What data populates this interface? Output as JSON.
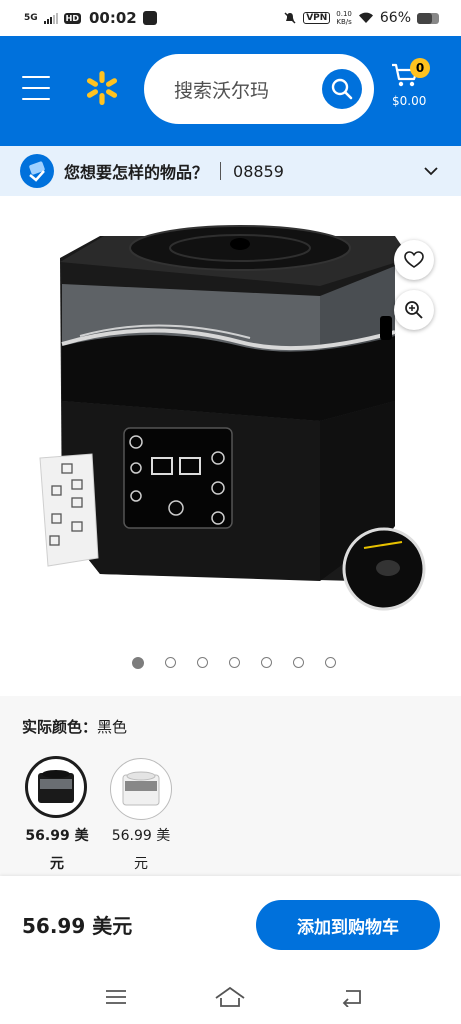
{
  "status_bar": {
    "network": "5G",
    "hd": "HD",
    "time": "00:02",
    "vpn": "VPN",
    "speed_value": "0.10",
    "speed_unit": "KB/s",
    "battery": "66%",
    "icons": [
      "signal-icon",
      "app-notification-icon",
      "mute-icon",
      "vpn-icon",
      "wifi-icon",
      "battery-icon"
    ]
  },
  "header": {
    "search_placeholder": "搜索沃尔玛",
    "cart_count": "0",
    "cart_total": "$0.00",
    "brand_color": "#0071dc",
    "badge_color": "#ffc220"
  },
  "location": {
    "question": "您想要怎样的物品？",
    "zip": "08859"
  },
  "gallery": {
    "image_count": 7,
    "active_index": 0,
    "icons": [
      "heart-icon",
      "zoom-icon"
    ]
  },
  "color_selection": {
    "label": "实际颜色：",
    "value": "黑色",
    "options": [
      {
        "price_line1": "56.99 美",
        "price_line2": "元",
        "selected": true
      },
      {
        "price_line1": "56.99 美",
        "price_line2": "元",
        "selected": false
      }
    ]
  },
  "purchase": {
    "price": "56.99 美元",
    "add_to_cart": "添加到购物车"
  }
}
